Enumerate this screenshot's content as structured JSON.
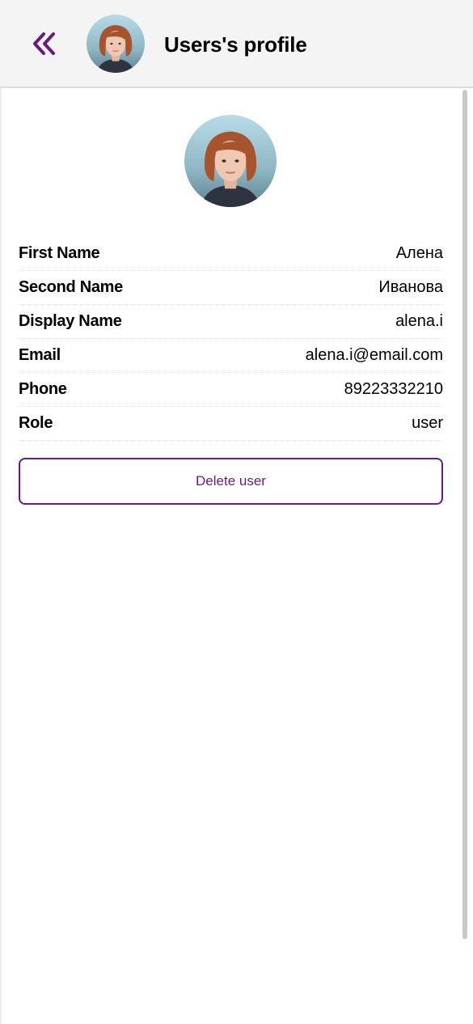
{
  "header": {
    "title": "Users's profile",
    "back_icon": "double-chevron-left-icon"
  },
  "profile": {
    "fields": [
      {
        "label": "First Name",
        "value": "Алена"
      },
      {
        "label": "Second Name",
        "value": "Иванова"
      },
      {
        "label": "Display Name",
        "value": "alena.i"
      },
      {
        "label": "Email",
        "value": "alena.i@email.com"
      },
      {
        "label": "Phone",
        "value": "89223332210"
      },
      {
        "label": "Role",
        "value": "user"
      }
    ]
  },
  "actions": {
    "delete_label": "Delete user"
  },
  "colors": {
    "accent": "#6b1a7f",
    "header_bg": "#f4f4f4"
  }
}
